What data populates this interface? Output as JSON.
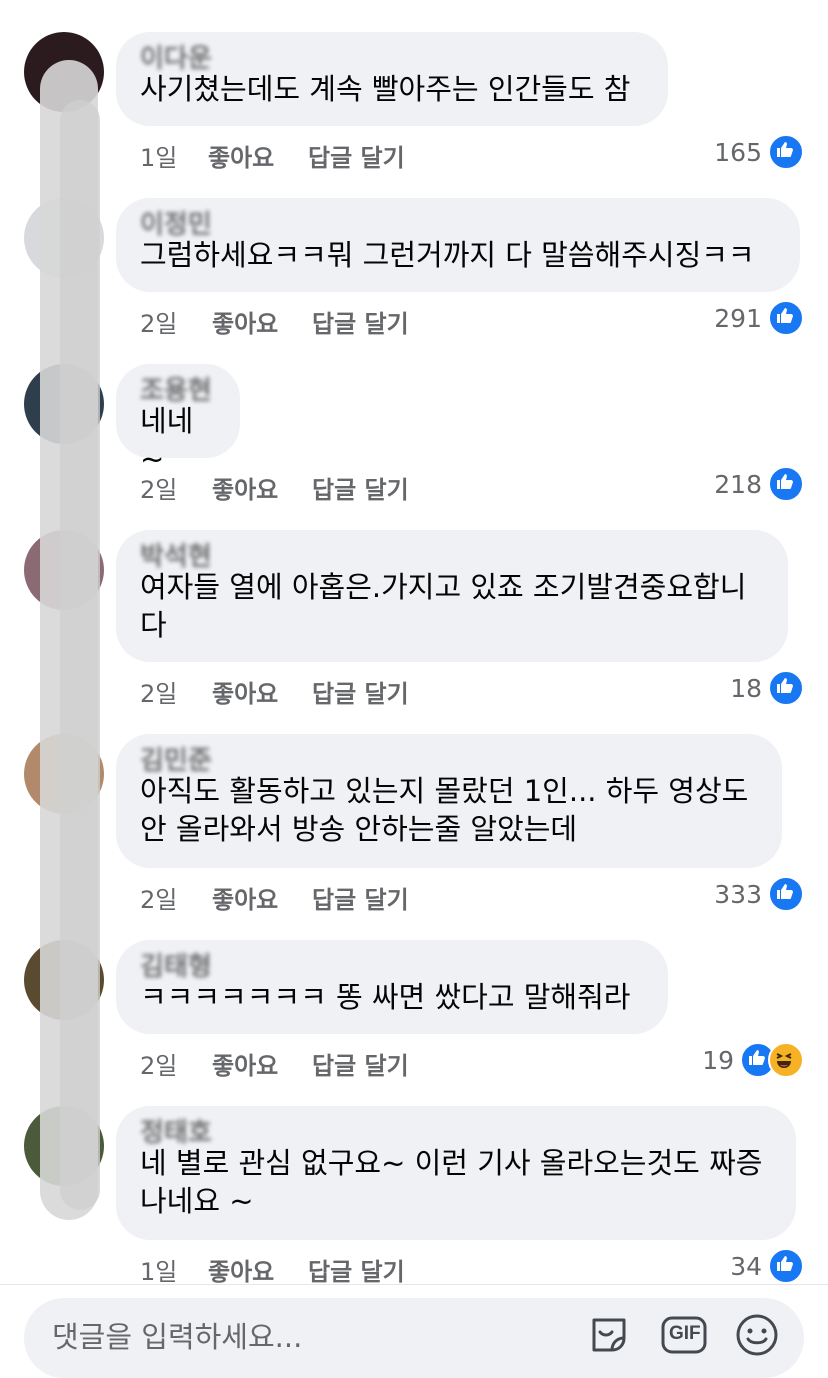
{
  "comments": [
    {
      "author": "이다운",
      "text": "사기쳤는데도 계속 빨아주는 인간들도 참",
      "time": "1일",
      "like": "좋아요",
      "reply": "답글 달기",
      "count": "165",
      "reactions": [
        "like"
      ]
    },
    {
      "author": "이정민",
      "text": "그럼하세요ㅋㅋ뭐 그런거까지 다 말씀해주시징ㅋㅋ",
      "time": "2일",
      "like": "좋아요",
      "reply": "답글 달기",
      "count": "291",
      "reactions": [
        "like"
      ]
    },
    {
      "author": "조용현",
      "text": "네네~",
      "time": "2일",
      "like": "좋아요",
      "reply": "답글 달기",
      "count": "218",
      "reactions": [
        "like"
      ]
    },
    {
      "author": "박석현",
      "text": "여자들 열에 아홉은.가지고 있죠 조기발견중요합니\n다",
      "time": "2일",
      "like": "좋아요",
      "reply": "답글 달기",
      "count": "18",
      "reactions": [
        "like"
      ]
    },
    {
      "author": "김민준",
      "text": "아직도 활동하고 있는지 몰랐던 1인... 하두 영상도\n안 올라와서 방송 안하는줄 알았는데",
      "time": "2일",
      "like": "좋아요",
      "reply": "답글 달기",
      "count": "333",
      "reactions": [
        "like"
      ]
    },
    {
      "author": "김태형",
      "text": "ㅋㅋㅋㅋㅋㅋㅋ 똥 싸면 쌌다고 말해줘라",
      "time": "2일",
      "like": "좋아요",
      "reply": "답글 달기",
      "count": "19",
      "reactions": [
        "like",
        "haha"
      ]
    },
    {
      "author": "정태호",
      "text": "네 별로 관심 없구요~ 이런 기사 올라오는것도 짜증\n나네요 ~",
      "time": "1일",
      "like": "좋아요",
      "reply": "답글 달기",
      "count": "34",
      "reactions": [
        "like"
      ]
    }
  ],
  "composer": {
    "placeholder": "댓글을 입력하세요...",
    "sticker_icon": "sticker-icon",
    "gif_label": "GIF",
    "emoji_icon": "emoji-icon"
  },
  "colors": {
    "bubble": "#eff1f4",
    "meta_text": "#65676b",
    "like_blue": "#1877f2",
    "haha_yellow": "#f7b125"
  }
}
